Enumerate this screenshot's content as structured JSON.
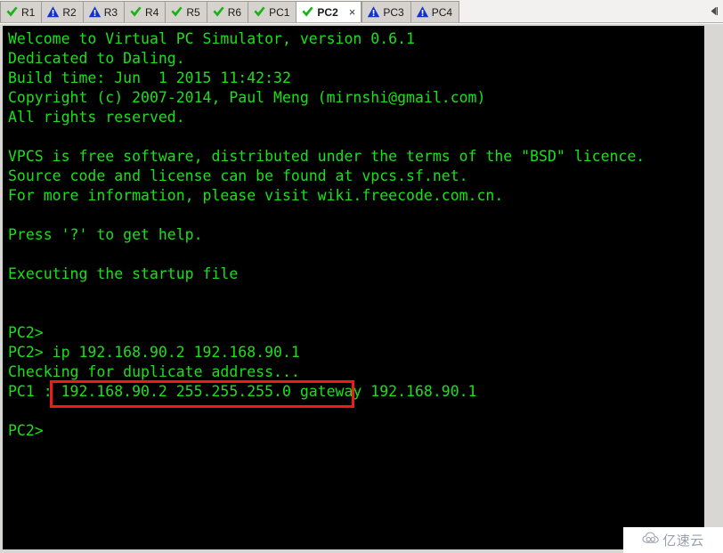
{
  "tabbar": {
    "scroll_left_icon": "scroll-left-icon",
    "tabs": [
      {
        "label": "R1",
        "status_icon": "check-icon",
        "active": false
      },
      {
        "label": "R2",
        "status_icon": "warning-icon",
        "active": false
      },
      {
        "label": "R3",
        "status_icon": "warning-icon",
        "active": false
      },
      {
        "label": "R4",
        "status_icon": "check-icon",
        "active": false
      },
      {
        "label": "R5",
        "status_icon": "check-icon",
        "active": false
      },
      {
        "label": "R6",
        "status_icon": "check-icon",
        "active": false
      },
      {
        "label": "PC1",
        "status_icon": "check-icon",
        "active": false
      },
      {
        "label": "PC2",
        "status_icon": "check-icon",
        "active": true,
        "close_label": "×"
      },
      {
        "label": "PC3",
        "status_icon": "warning-icon",
        "active": false
      },
      {
        "label": "PC4",
        "status_icon": "warning-icon",
        "active": false
      }
    ]
  },
  "terminal": {
    "colors": {
      "background": "#000000",
      "text": "#19e019",
      "annotation": "#f41a14"
    },
    "lines": [
      "Welcome to Virtual PC Simulator, version 0.6.1",
      "Dedicated to Daling.",
      "Build time: Jun  1 2015 11:42:32",
      "Copyright (c) 2007-2014, Paul Meng (mirnshi@gmail.com)",
      "All rights reserved.",
      "",
      "VPCS is free software, distributed under the terms of the \"BSD\" licence.",
      "Source code and license can be found at vpcs.sf.net.",
      "For more information, please visit wiki.freecode.com.cn.",
      "",
      "Press '?' to get help.",
      "",
      "Executing the startup file",
      "",
      "",
      "PC2>",
      "PC2> ip 192.168.90.2 192.168.90.1",
      "Checking for duplicate address...",
      "PC1 : 192.168.90.2 255.255.255.0 gateway 192.168.90.1",
      "",
      "PC2>"
    ]
  },
  "annotation": {
    "highlight_command": "ip 192.168.90.2 192.168.90.1"
  },
  "watermark": {
    "icon": "cloud-icon",
    "text": "亿速云"
  }
}
